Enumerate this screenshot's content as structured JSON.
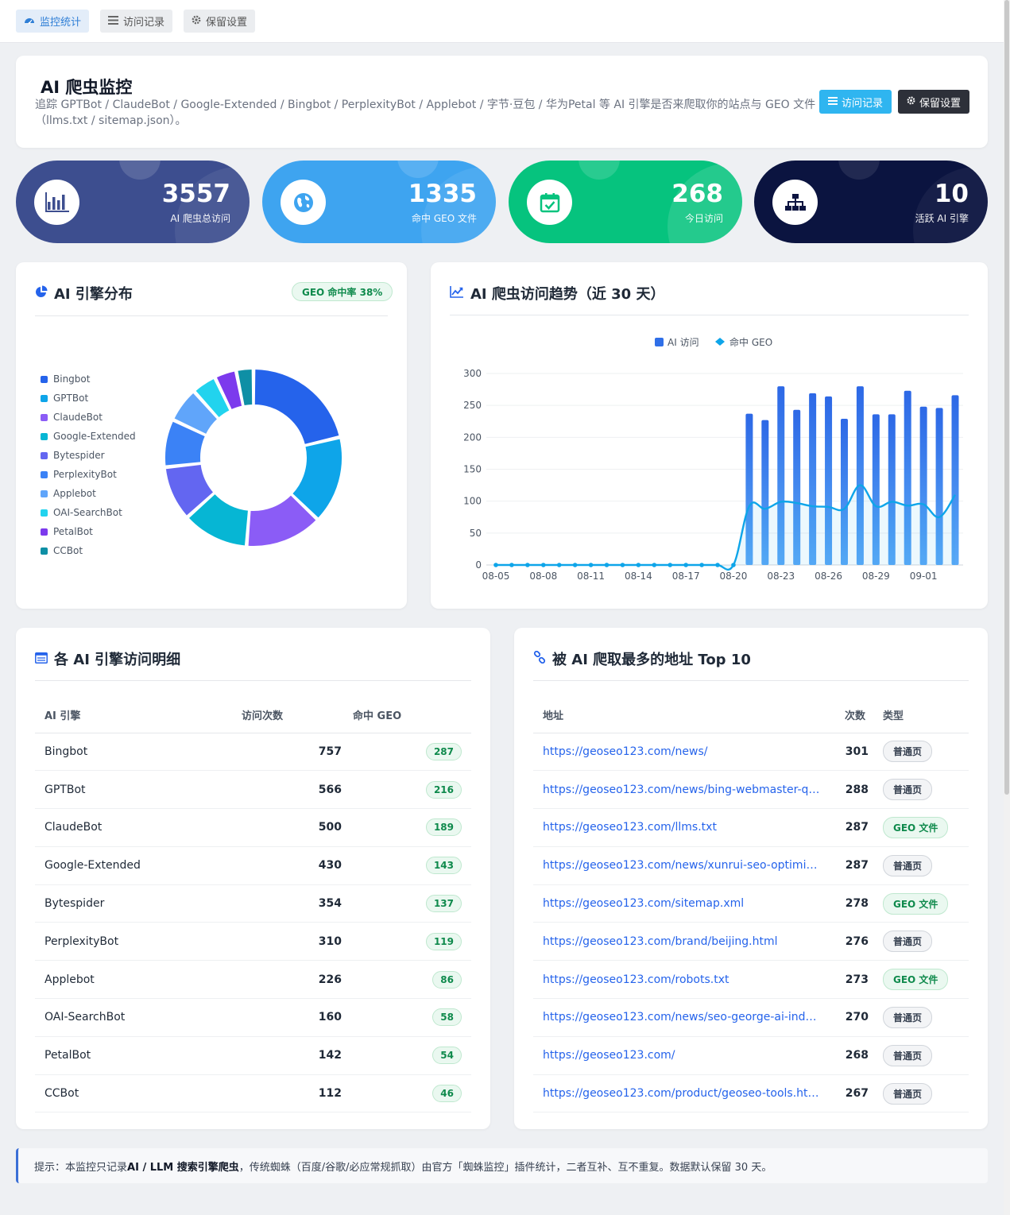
{
  "nav": {
    "tabs": [
      {
        "label": "监控统计",
        "icon": "dashboard-icon",
        "active": true
      },
      {
        "label": "访问记录",
        "icon": "list-icon",
        "active": false
      },
      {
        "label": "保留设置",
        "icon": "gear-icon",
        "active": false
      }
    ]
  },
  "header": {
    "title": "AI 爬虫监控",
    "description": "追踪 GPTBot / ClaudeBot / Google-Extended / Bingbot / PerplexityBot / Applebot / 字节·豆包 / 华为Petal 等 AI 引擎是否来爬取你的站点与 GEO 文件（llms.txt / sitemap.json）。",
    "btn_records": "访问记录",
    "btn_settings": "保留设置"
  },
  "stats": [
    {
      "value": "3557",
      "label": "AI 爬虫总访问",
      "icon": "bar-chart-icon",
      "color": "#3d4e8f"
    },
    {
      "value": "1335",
      "label": "命中 GEO 文件",
      "icon": "globe-icon",
      "color": "#3ea4f0"
    },
    {
      "value": "268",
      "label": "今日访问",
      "icon": "calendar-check-icon",
      "color": "#06c37e"
    },
    {
      "value": "10",
      "label": "活跃 AI 引擎",
      "icon": "sitemap-icon",
      "color": "#0b1440"
    }
  ],
  "distribution": {
    "title": "AI 引擎分布",
    "badge": "GEO 命中率 38%"
  },
  "trend": {
    "title": "AI 爬虫访问趋势（近 30 天）"
  },
  "engines_table": {
    "title": "各 AI 引擎访问明细",
    "headers": [
      "AI 引擎",
      "访问次数",
      "命中 GEO"
    ],
    "rows": [
      {
        "name": "Bingbot",
        "visits": "757",
        "geo": "287"
      },
      {
        "name": "GPTBot",
        "visits": "566",
        "geo": "216"
      },
      {
        "name": "ClaudeBot",
        "visits": "500",
        "geo": "189"
      },
      {
        "name": "Google-Extended",
        "visits": "430",
        "geo": "143"
      },
      {
        "name": "Bytespider",
        "visits": "354",
        "geo": "137"
      },
      {
        "name": "PerplexityBot",
        "visits": "310",
        "geo": "119"
      },
      {
        "name": "Applebot",
        "visits": "226",
        "geo": "86"
      },
      {
        "name": "OAI-SearchBot",
        "visits": "160",
        "geo": "58"
      },
      {
        "name": "PetalBot",
        "visits": "142",
        "geo": "54"
      },
      {
        "name": "CCBot",
        "visits": "112",
        "geo": "46"
      }
    ]
  },
  "urls_table": {
    "title": "被 AI 爬取最多的地址 Top 10",
    "headers": [
      "地址",
      "次数",
      "类型"
    ],
    "rows": [
      {
        "url": "https://geoseo123.com/news/",
        "count": "301",
        "type": "普通页",
        "geo": false
      },
      {
        "url": "https://geoseo123.com/news/bing-webmaster-qu...",
        "count": "288",
        "type": "普通页",
        "geo": false
      },
      {
        "url": "https://geoseo123.com/llms.txt",
        "count": "287",
        "type": "GEO 文件",
        "geo": true
      },
      {
        "url": "https://geoseo123.com/news/xunrui-seo-optimiz...",
        "count": "287",
        "type": "普通页",
        "geo": false
      },
      {
        "url": "https://geoseo123.com/sitemap.xml",
        "count": "278",
        "type": "GEO 文件",
        "geo": true
      },
      {
        "url": "https://geoseo123.com/brand/beijing.html",
        "count": "276",
        "type": "普通页",
        "geo": false
      },
      {
        "url": "https://geoseo123.com/robots.txt",
        "count": "273",
        "type": "GEO 文件",
        "geo": true
      },
      {
        "url": "https://geoseo123.com/news/seo-george-ai-inde...",
        "count": "270",
        "type": "普通页",
        "geo": false
      },
      {
        "url": "https://geoseo123.com/",
        "count": "268",
        "type": "普通页",
        "geo": false
      },
      {
        "url": "https://geoseo123.com/product/geoseo-tools.html",
        "count": "267",
        "type": "普通页",
        "geo": false
      }
    ]
  },
  "tip": {
    "prefix": "提示：本监控只记录 ",
    "bold": "AI / LLM 搜索引擎爬虫",
    "suffix": "，传统蜘蛛（百度/谷歌/必应常规抓取）由官方「蜘蛛监控」插件统计，二者互补、互不重复。数据默认保留 30 天。"
  },
  "chart_data": [
    {
      "type": "pie",
      "variant": "donut",
      "legend_position": "left",
      "categories": [
        "Bingbot",
        "GPTBot",
        "ClaudeBot",
        "Google-Extended",
        "Bytespider",
        "PerplexityBot",
        "Applebot",
        "OAI-SearchBot",
        "PetalBot",
        "CCBot"
      ],
      "values": [
        757,
        566,
        500,
        430,
        354,
        310,
        226,
        160,
        142,
        112
      ],
      "colors": [
        "#2563eb",
        "#0ea5e9",
        "#8b5cf6",
        "#06b6d4",
        "#6366f1",
        "#3b82f6",
        "#60a5fa",
        "#22d3ee",
        "#7c3aed",
        "#0e8fa5"
      ]
    },
    {
      "type": "bar",
      "legend": [
        "AI 访问",
        "命中 GEO"
      ],
      "series": [
        {
          "name": "AI 访问",
          "type": "bar",
          "color": "#2f6fe8",
          "values": [
            0,
            0,
            0,
            0,
            0,
            0,
            0,
            0,
            0,
            0,
            0,
            0,
            0,
            0,
            0,
            0,
            237,
            227,
            280,
            243,
            269,
            264,
            229,
            280,
            236,
            236,
            273,
            248,
            246,
            266
          ]
        },
        {
          "name": "命中 GEO",
          "type": "line",
          "color": "#0ea5e9",
          "values": [
            0,
            0,
            0,
            0,
            0,
            0,
            0,
            0,
            0,
            0,
            0,
            0,
            0,
            0,
            0,
            0,
            92,
            88,
            99,
            97,
            92,
            91,
            88,
            125,
            92,
            99,
            93,
            95,
            75,
            110
          ]
        }
      ],
      "x": [
        "08-05",
        "08-06",
        "08-07",
        "08-08",
        "08-09",
        "08-10",
        "08-11",
        "08-12",
        "08-13",
        "08-14",
        "08-15",
        "08-16",
        "08-17",
        "08-18",
        "08-19",
        "08-20",
        "08-21",
        "08-22",
        "08-23",
        "08-24",
        "08-25",
        "08-26",
        "08-27",
        "08-28",
        "08-29",
        "08-30",
        "08-31",
        "09-01",
        "09-02",
        "09-03"
      ],
      "xticks": [
        "08-05",
        "08-08",
        "08-11",
        "08-14",
        "08-17",
        "08-20",
        "08-23",
        "08-26",
        "08-29",
        "09-01"
      ],
      "ylim": [
        0,
        300
      ],
      "yticks": [
        "0",
        "50",
        "100",
        "150",
        "200",
        "250",
        "300"
      ],
      "grid": true
    }
  ]
}
